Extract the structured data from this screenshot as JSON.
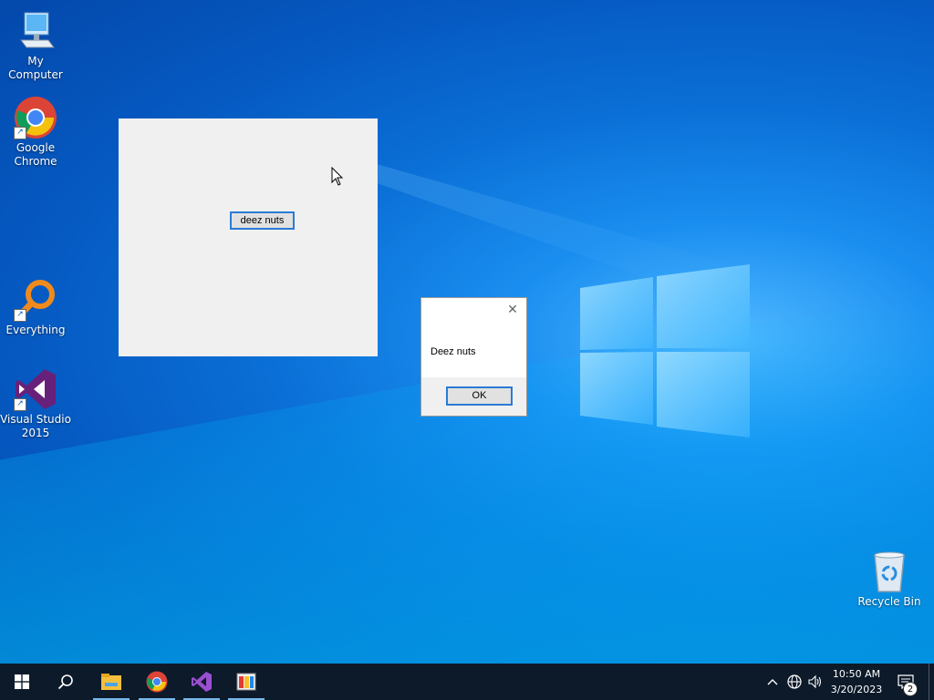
{
  "desktop": {
    "icons": [
      {
        "label": "My Computer",
        "icon": "computer-icon"
      },
      {
        "label": "Google Chrome",
        "icon": "chrome-icon"
      },
      {
        "label": "Everything",
        "icon": "everything-search-icon"
      },
      {
        "label": "Visual Studio 2015",
        "icon": "visual-studio-icon"
      },
      {
        "label": "Recycle Bin",
        "icon": "recycle-bin-icon"
      }
    ]
  },
  "app_window": {
    "button_label": "deez nuts",
    "background": "#f0f0f0"
  },
  "message_box": {
    "text": "Deez nuts",
    "ok_label": "OK",
    "close_icon": "close-icon"
  },
  "taskbar": {
    "items": [
      {
        "icon": "start-icon"
      },
      {
        "icon": "search-icon"
      },
      {
        "icon": "file-explorer-icon"
      },
      {
        "icon": "chrome-icon"
      },
      {
        "icon": "visual-studio-icon"
      },
      {
        "icon": "app-window-icon"
      }
    ],
    "tray": {
      "time": "10:50 AM",
      "date": "3/20/2023",
      "notification_count": "2"
    }
  },
  "colors": {
    "accent": "#2a7bd4",
    "taskbar": "#0c1a2a",
    "desktop": "#0a6fd6"
  }
}
